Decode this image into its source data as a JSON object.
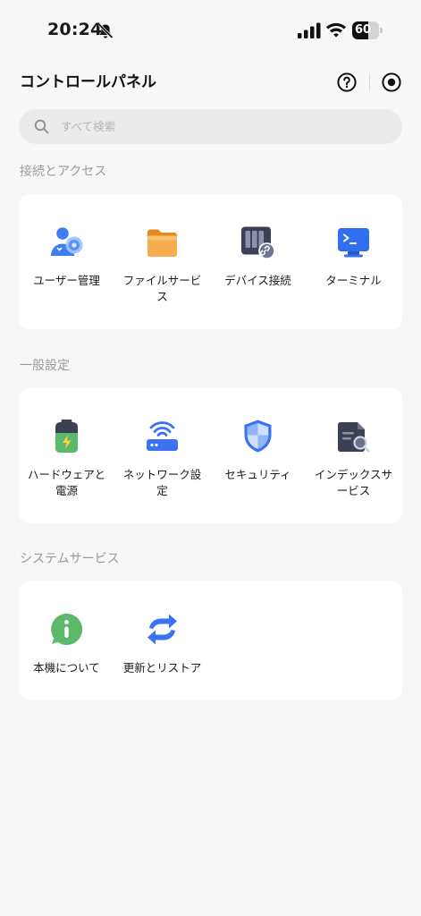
{
  "status_bar": {
    "time": "20:24",
    "battery_level": "60",
    "battery_fraction": 0.6,
    "icons": [
      "bell-muted-icon",
      "signal-bars-icon",
      "wifi-icon",
      "battery-icon"
    ]
  },
  "header": {
    "title": "コントロールパネル",
    "help_icon": "question-circle-icon",
    "target_icon": "target-icon"
  },
  "search": {
    "placeholder": "すべて検索",
    "value": ""
  },
  "sections": [
    {
      "title": "接続とアクセス",
      "items": [
        {
          "label": "ユーザー管理",
          "icon": "user-management-icon"
        },
        {
          "label": "ファイルサービス",
          "icon": "folder-icon"
        },
        {
          "label": "デバイス接続",
          "icon": "nas-device-link-icon"
        },
        {
          "label": "ターミナル",
          "icon": "terminal-icon"
        }
      ]
    },
    {
      "title": "一般設定",
      "items": [
        {
          "label": "ハードウェアと電源",
          "icon": "battery-power-icon"
        },
        {
          "label": "ネットワーク設定",
          "icon": "router-wifi-icon"
        },
        {
          "label": "セキュリティ",
          "icon": "shield-icon"
        },
        {
          "label": "インデックスサービス",
          "icon": "index-search-icon"
        }
      ]
    },
    {
      "title": "システムサービス",
      "items": [
        {
          "label": "本機について",
          "icon": "info-icon"
        },
        {
          "label": "更新とリストア",
          "icon": "refresh-icon"
        }
      ]
    }
  ],
  "colors": {
    "background": "#f7f7f7",
    "card": "#ffffff",
    "accent_blue": "#3a72f0",
    "icon_green": "#5cb96b",
    "icon_orange": "#f2a33b",
    "section_title": "#9a9a9a"
  }
}
